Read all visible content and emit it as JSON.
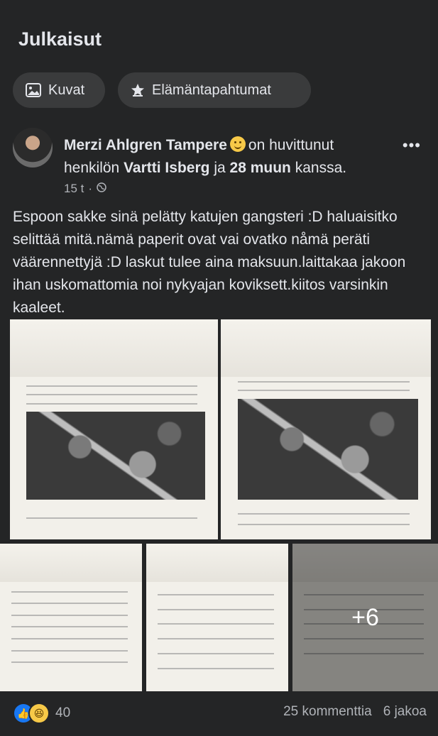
{
  "section": {
    "title": "Julkaisut"
  },
  "filters": [
    {
      "label": "Kuvat",
      "icon": "photo-icon"
    },
    {
      "label": "Elämäntapahtumat",
      "icon": "life-event-star-icon"
    }
  ],
  "post": {
    "author": "Merzi Ahlgren Tampere",
    "emoji": "slightly-smiling-face-icon",
    "feeling_text": "on huvittunut",
    "with_prefix": "henkilön",
    "with_name": "Vartti Isberg",
    "with_joiner": "ja",
    "with_others": "28 muun",
    "with_suffix": "kanssa.",
    "time": "15 t",
    "separator": "·",
    "privacy_icon": "public-globe-icon",
    "more_label": "•••",
    "text": "Espoon sakke sinä pelätty katujen gangsteri :D haluaisitko selittää mitä.nämä paperit ovat vai ovatko nåmä peräti väärennettyjä :D laskut tulee aina maksuun.laittakaa jakoon ihan uskomattomia noi nykyajan koviksett.kiitos varsinkin kaaleet.",
    "more_photos": "+6",
    "reactions_count": "40",
    "comments": "25 kommenttia",
    "shares": "6 jakoa"
  },
  "colors": {
    "background": "#242526",
    "pill": "#3a3b3c",
    "text": "#e4e6eb",
    "secondary": "#b0b3b8",
    "like_blue": "#1877f2"
  }
}
